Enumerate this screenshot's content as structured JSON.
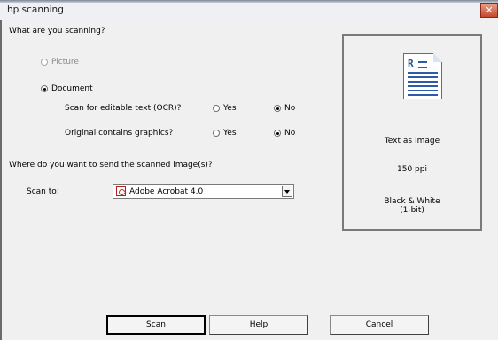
{
  "window": {
    "title": "hp scanning",
    "close_glyph": "✕"
  },
  "question1": "What are you scanning?",
  "scan_type": {
    "picture": {
      "label": "Picture",
      "selected": false,
      "enabled": false
    },
    "document": {
      "label": "Document",
      "selected": true,
      "enabled": true
    }
  },
  "ocr": {
    "label": "Scan for editable text (OCR)?",
    "yes": "Yes",
    "no": "No",
    "selected": "No"
  },
  "graphics": {
    "label": "Original contains graphics?",
    "yes": "Yes",
    "no": "No",
    "selected": "No"
  },
  "question2": "Where do you want to send the scanned image(s)?",
  "scan_to": {
    "label": "Scan to:",
    "value": "Adobe Acrobat 4.0",
    "icon": "acrobat-icon"
  },
  "preview": {
    "icon": "document-text-icon",
    "icon_letter": "R",
    "mode": "Text as Image",
    "resolution": "150 ppi",
    "color_line1": "Black & White",
    "color_line2": "(1-bit)"
  },
  "buttons": {
    "scan": "Scan",
    "help": "Help",
    "cancel": "Cancel"
  }
}
